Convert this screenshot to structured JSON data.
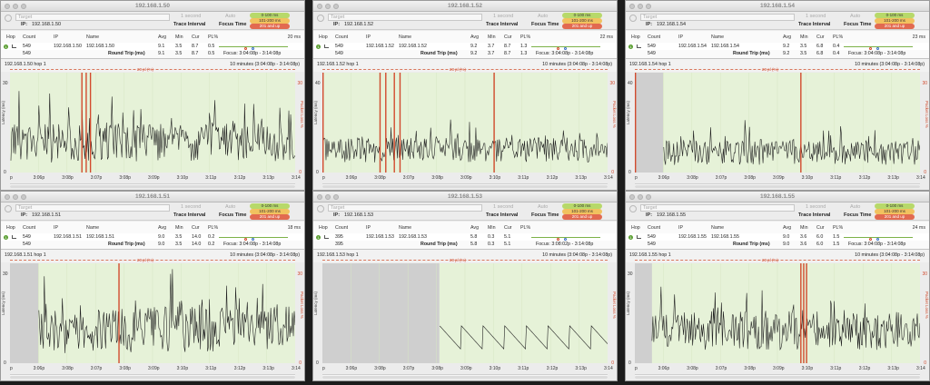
{
  "colors": {
    "green": "#b7d96a",
    "yellow": "#f1c25f",
    "red": "#e26a50",
    "plot_bg": "#e6f2d8",
    "loss": "#d24a2e"
  },
  "labels": {
    "target_placeholder": "Target",
    "ip_label": "IP:",
    "interval_value": "1 second",
    "interval_label": "Trace Interval",
    "focus_value": "Auto",
    "focus_label": "Focus Time",
    "legend": [
      "0-100 ms",
      "101-200 ms",
      "201 and up"
    ],
    "columns": {
      "hop": "Hop",
      "count": "Count",
      "ip": "IP",
      "name": "Name",
      "avg": "Avg",
      "min": "Min",
      "cur": "Cur",
      "pl": "PL%"
    },
    "round_trip": "Round Trip (ms)",
    "latency_axis": "Latency (ms)",
    "packet_loss_axis": "Packet Loss %",
    "loss_marker": "20 pl (%)",
    "range": "10 minutes (3:04:08p - 3:14:08p)"
  },
  "windows": [
    {
      "title": "192.168.1.50",
      "ip": "192.168.1.50",
      "hop": "1",
      "count": "549",
      "name": "192.168.1.50",
      "avg": "9.1",
      "min": "3.5",
      "cur": "8.7",
      "pl": "0.5",
      "ms": "20 ms",
      "rt": {
        "count": "549",
        "avg": "9.1",
        "min": "3.5",
        "cur": "8.7",
        "pl": "0.5"
      },
      "focus_text": "Focus: 3:04:08p - 3:14:08p",
      "chart_title": "192.168.1.50 hop 1",
      "chart_data": {
        "type": "line",
        "title": "192.168.1.50 hop 1",
        "xlabel": "",
        "ylabel": "Latency (ms)",
        "ylim": [
          0,
          30
        ],
        "x_ticks": [
          "p",
          "3:06p",
          "3:08p",
          "3:07p",
          "3:08p",
          "3:09p",
          "3:10p",
          "3:11p",
          "3:12p",
          "3:13p",
          "3:14"
        ],
        "y_ticks_left": [
          "30",
          "0"
        ],
        "y_ticks_right": [
          "30",
          "0"
        ],
        "baseline": 9,
        "variation": 6,
        "loss_spikes": [
          0.25,
          0.265,
          0.28
        ],
        "gap_end": 0.0
      }
    },
    {
      "title": "192.168.1.52",
      "ip": "192.168.1.52",
      "hop": "1",
      "count": "549",
      "name": "192.168.1.52",
      "avg": "9.2",
      "min": "3.7",
      "cur": "8.7",
      "pl": "1.3",
      "ms": "22 ms",
      "rt": {
        "count": "549",
        "avg": "9.2",
        "min": "3.7",
        "cur": "8.7",
        "pl": "1.3"
      },
      "focus_text": "Focus: 3:04:08p - 3:14:08p",
      "chart_title": "192.168.1.52 hop 1",
      "chart_data": {
        "type": "line",
        "title": "192.168.1.52 hop 1",
        "xlabel": "",
        "ylabel": "Latency (ms)",
        "ylim": [
          0,
          40
        ],
        "x_ticks": [
          "p",
          "3:06p",
          "3:08p",
          "3:07p",
          "3:08p",
          "3:09p",
          "3:10p",
          "3:11p",
          "3:12p",
          "3:13p",
          "3:14"
        ],
        "y_ticks_left": [
          "40",
          "0"
        ],
        "y_ticks_right": [
          "30",
          "0"
        ],
        "baseline": 9,
        "variation": 5,
        "loss_spikes": [
          0.0,
          0.2,
          0.22,
          0.25,
          0.27,
          0.6
        ],
        "gap_end": 0.0
      }
    },
    {
      "title": "192.168.1.54",
      "ip": "192.168.1.54",
      "hop": "1",
      "count": "549",
      "name": "192.168.1.54",
      "avg": "9.2",
      "min": "3.5",
      "cur": "6.8",
      "pl": "0.4",
      "ms": "23 ms",
      "rt": {
        "count": "549",
        "avg": "9.2",
        "min": "3.5",
        "cur": "6.8",
        "pl": "0.4"
      },
      "focus_text": "Focus: 3:04:08p - 3:14:08p",
      "chart_title": "192.168.1.54 hop 1",
      "chart_data": {
        "type": "line",
        "title": "192.168.1.54 hop 1",
        "xlabel": "",
        "ylabel": "Latency (ms)",
        "ylim": [
          0,
          40
        ],
        "x_ticks": [
          "p",
          "3:06p",
          "3:08p",
          "3:07p",
          "3:08p",
          "3:09p",
          "3:10p",
          "3:11p",
          "3:12p",
          "3:13p",
          "3:14"
        ],
        "y_ticks_left": [
          "40",
          "0"
        ],
        "y_ticks_right": [
          "30",
          "0"
        ],
        "baseline": 8,
        "variation": 5,
        "loss_spikes": [
          0.0,
          0.58
        ],
        "gap_end": 0.1
      }
    },
    {
      "title": "192.168.1.51",
      "ip": "192.168.1.51",
      "hop": "1",
      "count": "549",
      "name": "192.168.1.51",
      "avg": "9.0",
      "min": "3.5",
      "cur": "14.0",
      "pl": "0.2",
      "ms": "18 ms",
      "rt": {
        "count": "549",
        "avg": "9.0",
        "min": "3.5",
        "cur": "14.0",
        "pl": "0.2"
      },
      "focus_text": "Focus: 3:04:08p - 3:14:08p",
      "chart_title": "192.168.1.51 hop 1",
      "chart_data": {
        "type": "line",
        "title": "192.168.1.51 hop 1",
        "xlabel": "",
        "ylabel": "Latency (ms)",
        "ylim": [
          0,
          30
        ],
        "x_ticks": [
          "p",
          "3:06p",
          "3:08p",
          "3:07p",
          "3:08p",
          "3:09p",
          "3:10p",
          "3:11p",
          "3:12p",
          "3:13p",
          "3:14"
        ],
        "y_ticks_left": [
          "30",
          "0"
        ],
        "y_ticks_right": [
          "30",
          "0"
        ],
        "baseline": 10,
        "variation": 7,
        "loss_spikes": [
          0.38
        ],
        "gap_end": 0.1
      }
    },
    {
      "title": "192.168.1.53",
      "ip": "192.168.1.53",
      "hop": "1",
      "count": "395",
      "name": "192.168.1.53",
      "avg": "5.8",
      "min": "0.3",
      "cur": "5.1",
      "pl": "",
      "ms": "",
      "rt": {
        "count": "395",
        "avg": "5.8",
        "min": "0.3",
        "cur": "5.1",
        "pl": ""
      },
      "focus_text": "Focus: 3:08:02p - 3:14:08p",
      "chart_title": "192.168.1.53 hop 1",
      "chart_data": {
        "type": "line",
        "title": "192.168.1.53 hop 1",
        "xlabel": "",
        "ylabel": "Latency (ms)",
        "ylim": [
          0,
          30
        ],
        "x_ticks": [
          "p",
          "3:06p",
          "3:08p",
          "3:07p",
          "3:08p",
          "3:09p",
          "3:10p",
          "3:11p",
          "3:12p",
          "3:13p",
          "3:14"
        ],
        "y_ticks_left": [
          "",
          "0"
        ],
        "y_ticks_right": [
          "",
          "0"
        ],
        "baseline": 5,
        "variation": 4,
        "loss_spikes": [],
        "gap_end": 0.41,
        "sawtooth": true
      }
    },
    {
      "title": "192.168.1.55",
      "ip": "192.168.1.55",
      "hop": "1",
      "count": "549",
      "name": "192.168.1.55",
      "avg": "9.0",
      "min": "3.6",
      "cur": "6.0",
      "pl": "1.5",
      "ms": "24 ms",
      "rt": {
        "count": "549",
        "avg": "9.0",
        "min": "3.6",
        "cur": "6.0",
        "pl": "1.5"
      },
      "focus_text": "Focus: 3:04:08p - 3:14:08p",
      "chart_title": "192.168.1.55 hop 1",
      "chart_data": {
        "type": "line",
        "title": "192.168.1.55 hop 1",
        "xlabel": "",
        "ylabel": "Latency (ms)",
        "ylim": [
          0,
          30
        ],
        "x_ticks": [
          "p",
          "3:06p",
          "3:08p",
          "3:07p",
          "3:08p",
          "3:09p",
          "3:10p",
          "3:11p",
          "3:12p",
          "3:13p",
          "3:14"
        ],
        "y_ticks_left": [
          "30",
          "0"
        ],
        "y_ticks_right": [
          "30",
          "0"
        ],
        "baseline": 10,
        "variation": 6,
        "loss_spikes": [
          0.58,
          0.59,
          0.6
        ],
        "gap_end": 0.06
      }
    }
  ]
}
